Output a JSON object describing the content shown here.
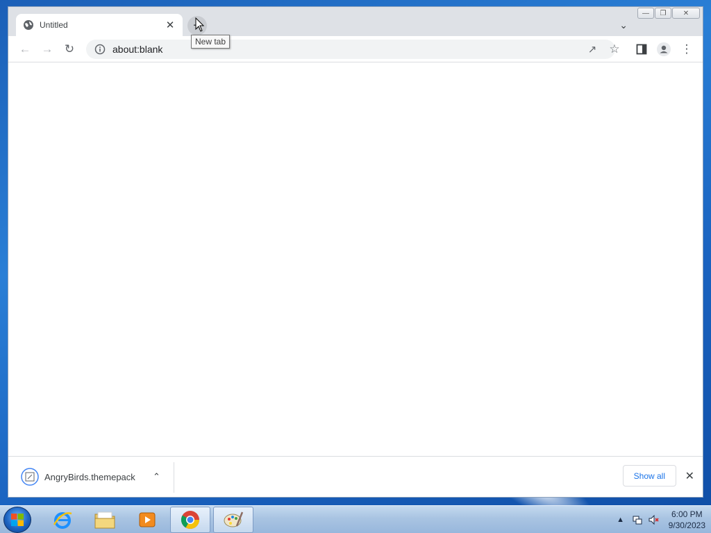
{
  "browser": {
    "tab": {
      "title": "Untitled"
    },
    "newtab_tooltip": "New tab",
    "address": {
      "url": "about:blank"
    },
    "download": {
      "filename": "AngryBirds.themepack",
      "show_all": "Show all"
    }
  },
  "taskbar": {
    "apps": [
      "internet-explorer",
      "file-explorer",
      "media-player",
      "chrome",
      "paint"
    ],
    "clock": {
      "time": "6:00 PM",
      "date": "9/30/2023"
    }
  },
  "colors": {
    "accent": "#1a73e8",
    "tab_bg": "#ffffff",
    "frame": "#dee1e6"
  }
}
